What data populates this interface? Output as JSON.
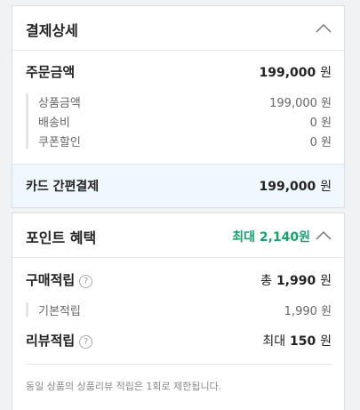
{
  "payment": {
    "title": "결제상세",
    "order_total": {
      "label": "주문금액",
      "amount": "199,000",
      "unit": "원"
    },
    "details": [
      {
        "label": "상품금액",
        "amount": "199,000",
        "unit": "원"
      },
      {
        "label": "배송비",
        "amount": "0",
        "unit": "원"
      },
      {
        "label": "쿠폰할인",
        "amount": "0",
        "unit": "원"
      }
    ],
    "method": {
      "label": "카드 간편결제",
      "amount": "199,000",
      "unit": "원"
    }
  },
  "benefit": {
    "title": "포인트 혜택",
    "max_label": "최대 2,140원",
    "purchase": {
      "label": "구매적립",
      "prefix": "총",
      "amount": "1,990",
      "unit": "원",
      "help": "?"
    },
    "basic": {
      "label": "기본적립",
      "amount": "1,990",
      "unit": "원"
    },
    "review": {
      "label": "리뷰적립",
      "prefix": "최대",
      "amount": "150",
      "unit": "원",
      "help": "?"
    },
    "notice": "동일 상품의 상품리뷰 적립은 1회로 제한됩니다."
  },
  "colors": {
    "accent_green": "#13a66b",
    "highlight_bg": "#f0f7fd"
  },
  "icons": {
    "collapse": "chevron-up-icon",
    "help": "question-circle-icon"
  }
}
